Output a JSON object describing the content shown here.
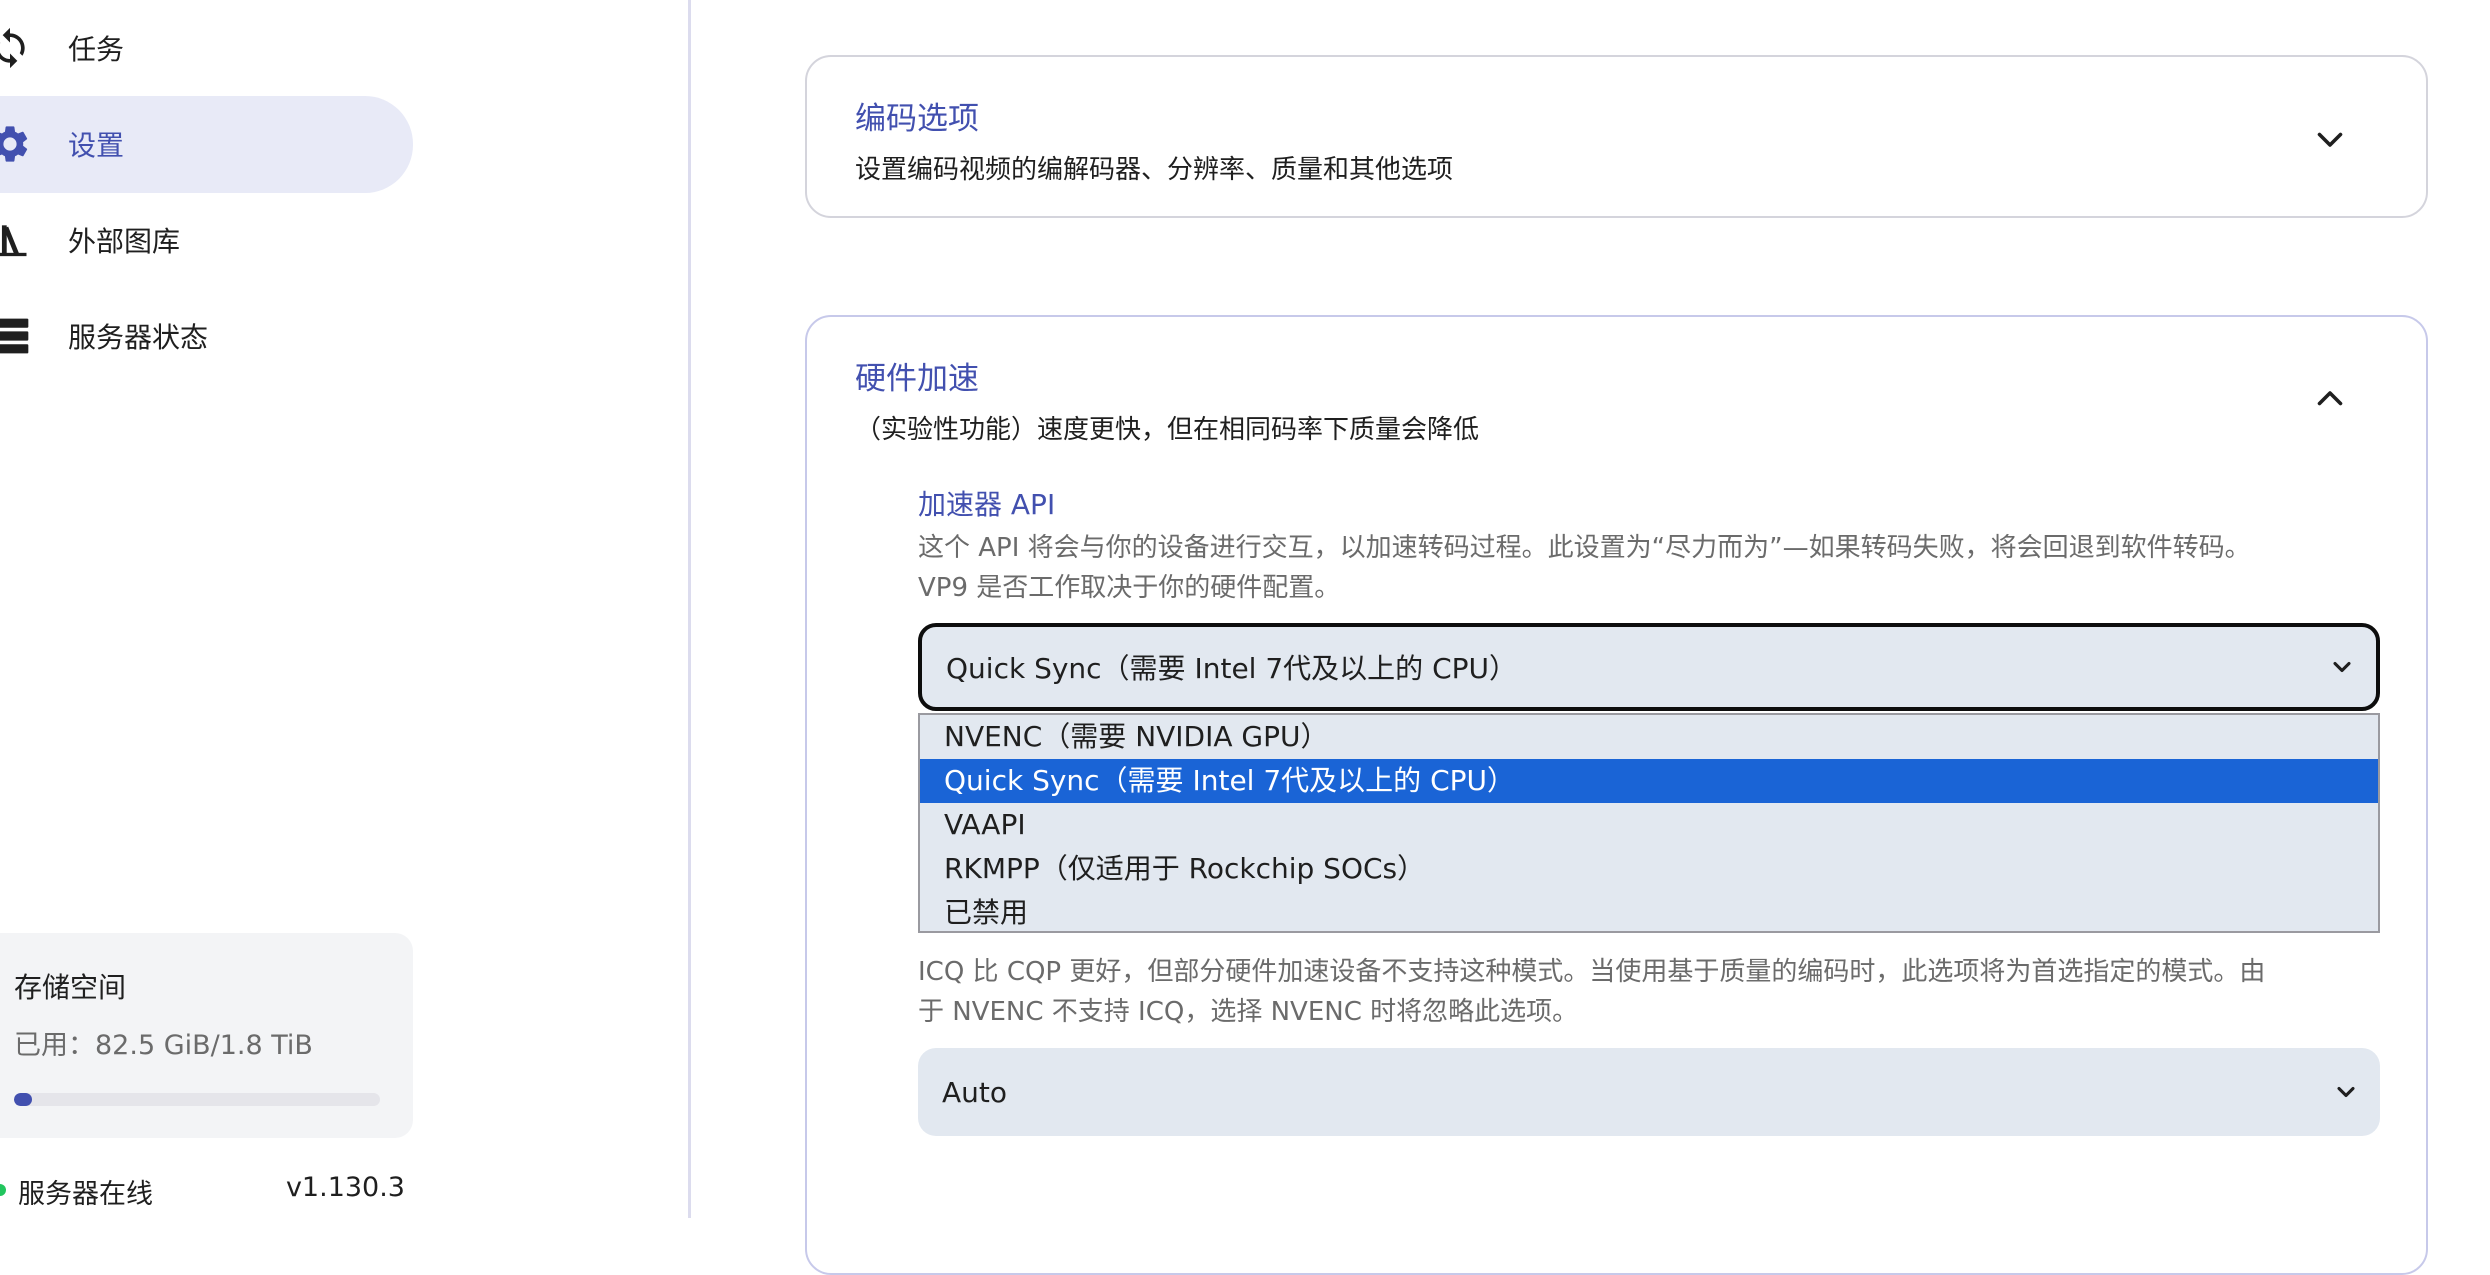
{
  "sidebar": {
    "items": [
      {
        "label": "任务",
        "icon": "sync-icon"
      },
      {
        "label": "设置",
        "icon": "gear-icon",
        "active": true
      },
      {
        "label": "外部图库",
        "icon": "library-icon"
      },
      {
        "label": "服务器状态",
        "icon": "server-icon"
      }
    ],
    "storage": {
      "title": "存储空间",
      "used_text": "已用：82.5 GiB/1.8 TiB",
      "used_fraction": 0.045
    },
    "status": {
      "text": "服务器在线",
      "version": "v1.130.3"
    }
  },
  "main": {
    "encoding": {
      "title": "编码选项",
      "desc": "设置编码视频的编解码器、分辨率、质量和其他选项"
    },
    "hardware": {
      "title": "硬件加速",
      "desc": "（实验性功能）速度更快，但在相同码率下质量会降低",
      "accel_api": {
        "title": "加速器 API",
        "desc_line1": "这个 API 将会与你的设备进行交互，以加速转码过程。此设置为“尽力而为”—如果转码失败，将会回退到软件转码。",
        "desc_line2": "VP9 是否工作取决于你的硬件配置。",
        "selected": "Quick Sync（需要 Intel 7代及以上的 CPU）",
        "options": [
          "NVENC（需要 NVIDIA GPU）",
          "Quick Sync（需要 Intel 7代及以上的 CPU）",
          "VAAPI",
          "RKMPP（仅适用于 Rockchip SOCs）",
          "已禁用"
        ],
        "selected_index": 1
      },
      "constant_quality": {
        "desc_line1": "ICQ 比 CQP 更好，但部分硬件加速设备不支持这种模式。当使用基于质量的编码时，此选项将为首选指定的模式。由",
        "desc_line2": "于 NVENC 不支持 ICQ，选择 NVENC 时将忽略此选项。",
        "selected": "Auto"
      }
    }
  },
  "colors": {
    "accent": "#4250af",
    "active_bg": "#e8eaf7",
    "select_bg": "#e2e8f0",
    "highlight": "#1a64d6",
    "online": "#22c55e"
  }
}
